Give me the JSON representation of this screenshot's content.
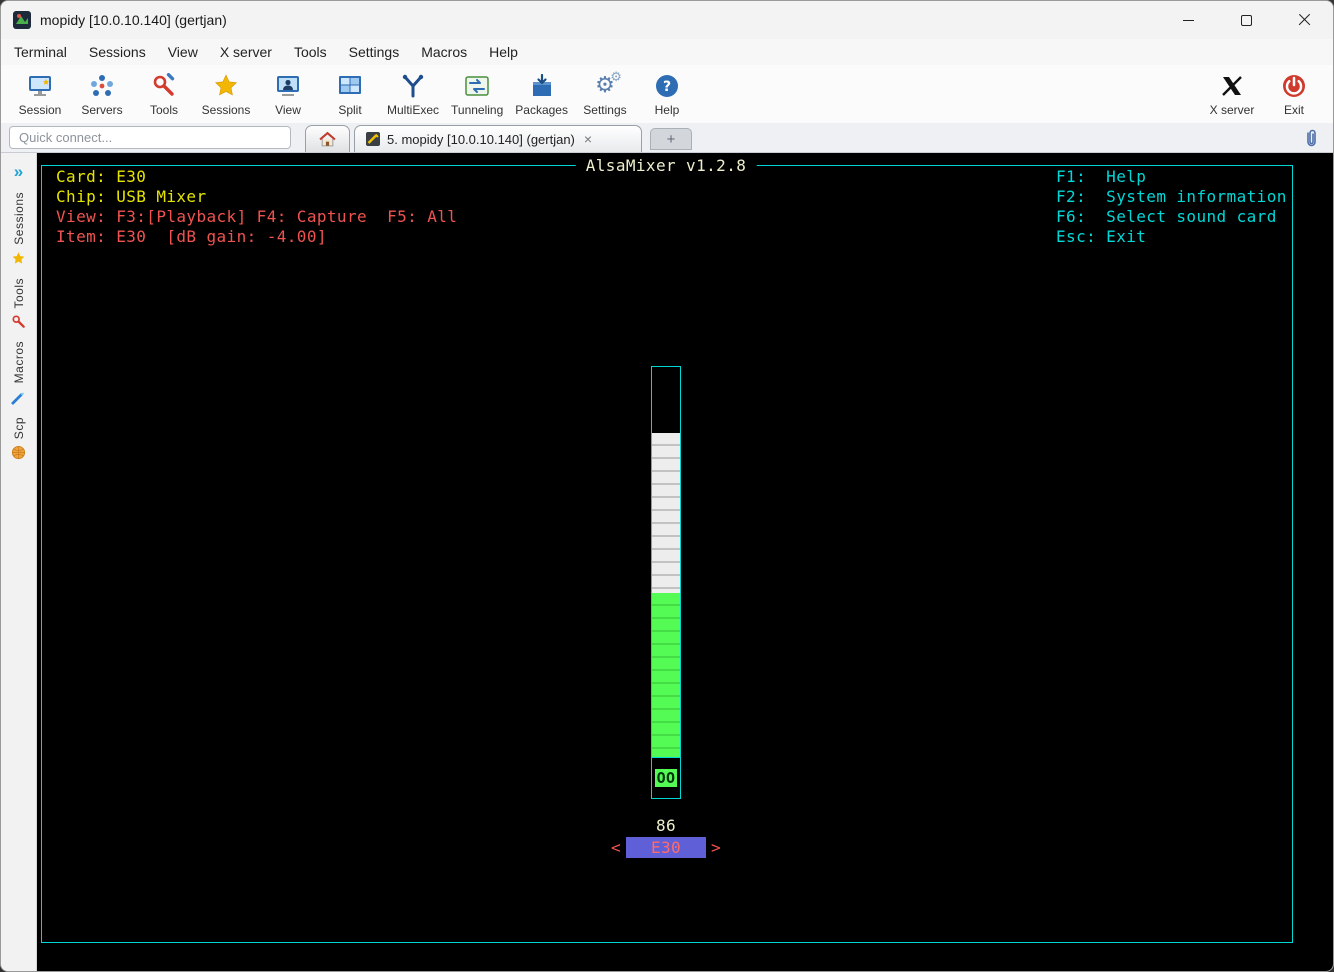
{
  "window": {
    "title": "mopidy [10.0.10.140] (gertjan)"
  },
  "menubar": {
    "items": [
      "Terminal",
      "Sessions",
      "View",
      "X server",
      "Tools",
      "Settings",
      "Macros",
      "Help"
    ]
  },
  "toolbar": {
    "items": [
      {
        "label": "Session",
        "icon": "session-icon"
      },
      {
        "label": "Servers",
        "icon": "servers-icon"
      },
      {
        "label": "Tools",
        "icon": "tools-icon"
      },
      {
        "label": "Sessions",
        "icon": "sessions-star-icon"
      },
      {
        "label": "View",
        "icon": "view-icon"
      },
      {
        "label": "Split",
        "icon": "split-icon"
      },
      {
        "label": "MultiExec",
        "icon": "multiexec-icon"
      },
      {
        "label": "Tunneling",
        "icon": "tunneling-icon"
      },
      {
        "label": "Packages",
        "icon": "packages-icon"
      },
      {
        "label": "Settings",
        "icon": "settings-icon"
      },
      {
        "label": "Help",
        "icon": "help-icon"
      }
    ],
    "right_items": [
      {
        "label": "X server",
        "icon": "xserver-icon"
      },
      {
        "label": "Exit",
        "icon": "exit-icon"
      }
    ]
  },
  "tabbar": {
    "quick_connect_placeholder": "Quick connect...",
    "active_tab_label": "5. mopidy [10.0.10.140] (gertjan)",
    "close_tab_glyph": "×",
    "new_tab_glyph": "+"
  },
  "sidebar": {
    "expand_glyph": "»",
    "items": [
      "Sessions",
      "Tools",
      "Macros",
      "Scp"
    ]
  },
  "terminal": {
    "app_title": "AlsaMixer v1.2.8",
    "info_lines": [
      "Card: E30",
      "Chip: USB Mixer",
      "View: F3:[Playback] F4: Capture  F5: All",
      "Item: E30  [dB gain: -4.00]"
    ],
    "help_lines": [
      "F1:  Help",
      "F2:  System information",
      "F6:  Select sound card",
      "Esc: Exit"
    ],
    "mixer": {
      "volume_percent": "86",
      "mute_state": "OO",
      "control_name": "E30",
      "left_arrow": "<",
      "right_arrow": ">"
    },
    "colors": {
      "border_cyan": "#00d7d7",
      "text_yellow": "#e5e500",
      "text_red": "#ef5350",
      "text_cyan": "#00d7d7",
      "bar_green": "#54fb54",
      "bar_white": "#ededed",
      "selection_bg": "#5f5fd7",
      "selection_fg": "#ff6b68",
      "title_color": "#eeeecd",
      "terminal_bg": "#000000"
    }
  }
}
